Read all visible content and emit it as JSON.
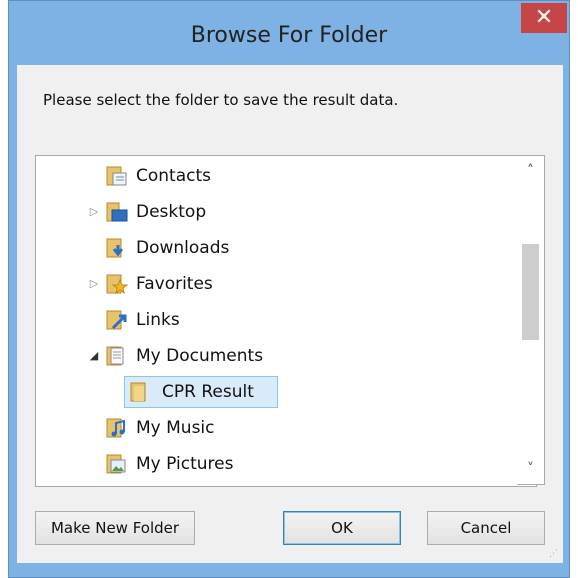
{
  "dialog": {
    "title": "Browse For Folder",
    "close_glyph": "✕",
    "prompt": "Please select the folder to save the result data."
  },
  "tree": {
    "items": [
      {
        "label": "Contacts",
        "icon": "contacts-folder-icon",
        "expander": ""
      },
      {
        "label": "Desktop",
        "icon": "desktop-folder-icon",
        "expander": "▷"
      },
      {
        "label": "Downloads",
        "icon": "downloads-folder-icon",
        "expander": ""
      },
      {
        "label": "Favorites",
        "icon": "favorites-folder-icon",
        "expander": "▷"
      },
      {
        "label": "Links",
        "icon": "links-folder-icon",
        "expander": ""
      },
      {
        "label": "My Documents",
        "icon": "documents-folder-icon",
        "expander": "◢"
      },
      {
        "label": "CPR Result",
        "icon": "folder-icon",
        "expander": "",
        "selected": true
      },
      {
        "label": "My Music",
        "icon": "music-folder-icon",
        "expander": ""
      },
      {
        "label": "My Pictures",
        "icon": "pictures-folder-icon",
        "expander": ""
      }
    ]
  },
  "scrollbar": {
    "up": "˄",
    "down": "˅"
  },
  "buttons": {
    "new_folder": "Make New Folder",
    "ok": "OK",
    "cancel": "Cancel"
  },
  "colors": {
    "frame": "#7fb2e4",
    "close": "#c74545",
    "selection": "#d9ebfa"
  }
}
